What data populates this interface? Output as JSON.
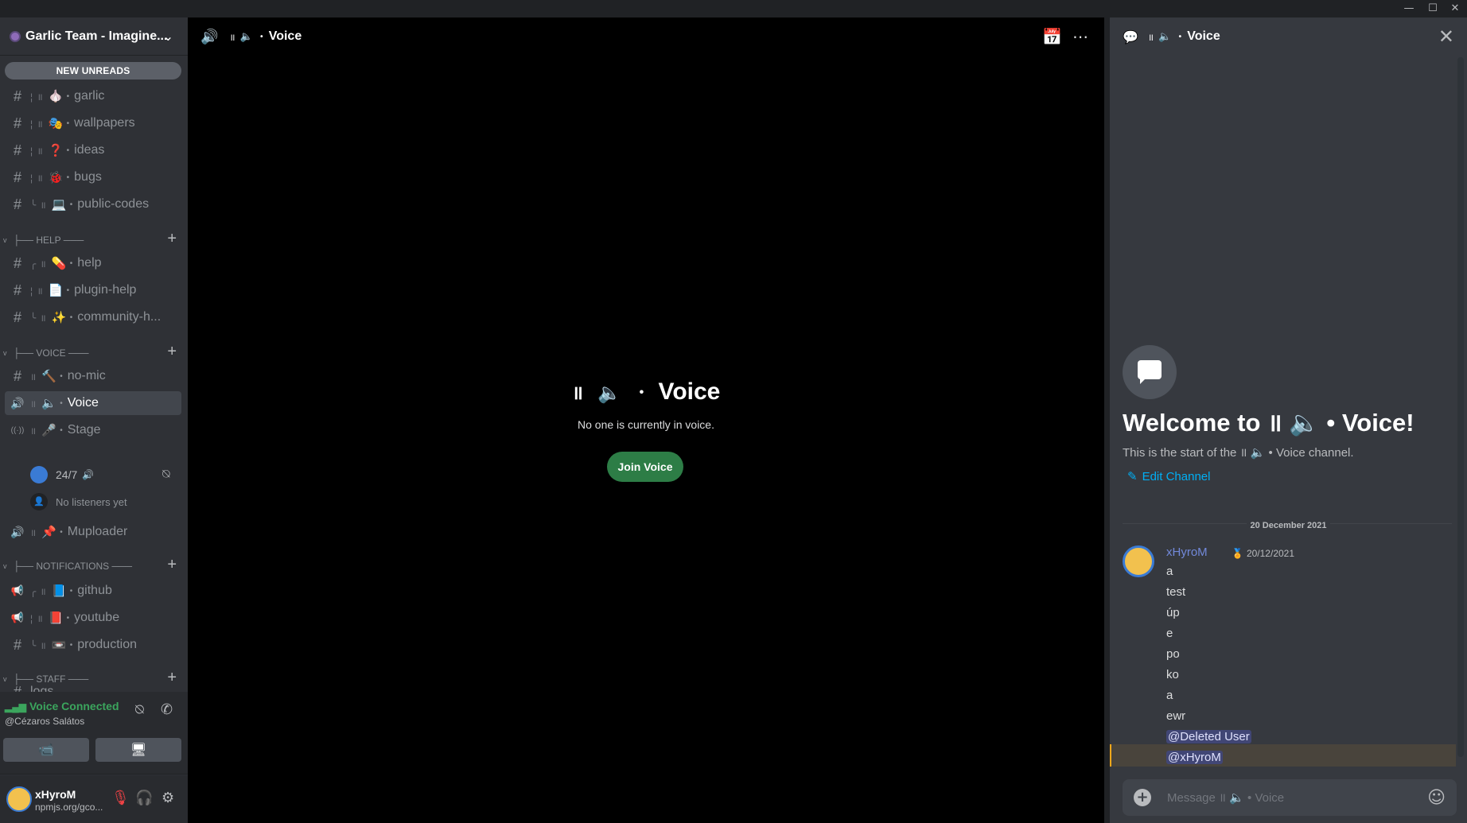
{
  "window": {
    "minimize": "—",
    "maximize": "☐",
    "close": "✕"
  },
  "guild": {
    "name": "Garlic Team - Imagine...",
    "chevron": "⌄"
  },
  "new_unreads": "NEW UNREADS",
  "channels_top": [
    {
      "icon": "#",
      "tree": "¦ ॥",
      "emoji": "🧄",
      "name": "garlic"
    },
    {
      "icon": "#",
      "tree": "¦ ॥",
      "emoji": "🎭",
      "name": "wallpapers"
    },
    {
      "icon": "#",
      "tree": "¦ ॥",
      "emoji": "❓",
      "name": "ideas"
    },
    {
      "icon": "#",
      "tree": "¦ ॥",
      "emoji": "🐞",
      "name": "bugs"
    },
    {
      "icon": "#",
      "tree": "╰ ॥",
      "emoji": "💻",
      "name": "public-codes"
    }
  ],
  "categories": {
    "help": "├── HELP ───",
    "voice": "├── VOICE ───",
    "notifications": "├── NOTIFICATIONS ───",
    "staff": "├── STAFF ───"
  },
  "channels_help": [
    {
      "icon": "#",
      "tree": "╭ ॥",
      "emoji": "💊",
      "name": "help"
    },
    {
      "icon": "#",
      "tree": "¦ ॥",
      "emoji": "📄",
      "name": "plugin-help"
    },
    {
      "icon": "#",
      "tree": "╰ ॥",
      "emoji": "✨",
      "name": "community-h..."
    }
  ],
  "channels_voice": [
    {
      "icon": "#",
      "tree": "॥",
      "emoji": "🔨",
      "name": "no-mic"
    },
    {
      "icon": "🔊",
      "tree": "॥",
      "emoji": "🔈",
      "name": "Voice"
    },
    {
      "icon": "((·))",
      "tree": "॥",
      "emoji": "🎤",
      "name": "Stage"
    }
  ],
  "stage_sub": {
    "label": "24/7",
    "speaker": "🔊",
    "no_listeners": "No listeners yet"
  },
  "mupload": {
    "icon": "🔊",
    "tree": "॥",
    "emoji": "📌",
    "name": "Muploader"
  },
  "channels_notifications": [
    {
      "icon": "📢",
      "tree": "╭ ॥",
      "emoji": "📘",
      "name": "github"
    },
    {
      "icon": "📢",
      "tree": "¦ ॥",
      "emoji": "📕",
      "name": "youtube"
    },
    {
      "icon": "#",
      "tree": "╰ ॥",
      "emoji": "📼",
      "name": "production"
    }
  ],
  "channels_staff": [
    {
      "icon": "#",
      "name": "logs"
    }
  ],
  "voice_panel": {
    "status": "Voice Connected",
    "location": "@Cézaros Salátos",
    "camera": "📹",
    "screen": "🖥"
  },
  "user": {
    "name": "xHyroM",
    "status": "npmjs.org/gco..."
  },
  "main": {
    "title": "Voice",
    "header_icon": "🔊",
    "center_title": "Voice",
    "center_sub": "No one is currently in voice.",
    "join_label": "Join Voice"
  },
  "chat": {
    "title": "Voice",
    "welcome_title": "Welcome to ॥ 🔈 • Voice!",
    "welcome_sub": "This is the start of the ॥ 🔈 • Voice channel.",
    "edit_channel": "Edit Channel",
    "date": "20 December 2021",
    "author": "xHyroM",
    "timestamp": "20/12/2021",
    "lines": [
      "a",
      "test",
      "úp",
      "e",
      "po",
      "ko",
      "a",
      "ewr"
    ],
    "mentions": [
      "@Deleted User",
      "@xHyroM"
    ],
    "placeholder": "Message ॥ 🔈 • Voice"
  },
  "colors": {
    "sidebar": "#2f3136",
    "chat": "#36393f",
    "accent_green": "#3ba55d",
    "mention_bg": "#414675",
    "join": "#2d7d46"
  }
}
